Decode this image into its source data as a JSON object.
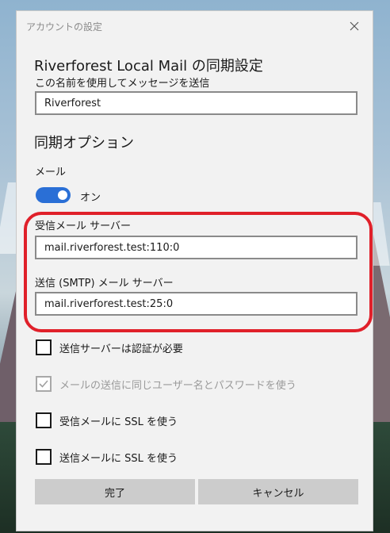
{
  "dialog": {
    "title": "アカウントの設定",
    "heading": "Riverforest Local Mail の同期設定",
    "name_label": "この名前を使用してメッセージを送信",
    "name_value": "Riverforest",
    "sync_options_title": "同期オプション",
    "mail_label": "メール",
    "mail_toggle": {
      "state_text": "オン",
      "on": true,
      "color": "#2a6fd6"
    },
    "incoming_server_label": "受信メール サーバー",
    "incoming_server_value": "mail.riverforest.test:110:0",
    "outgoing_server_label": "送信 (SMTP) メール サーバー",
    "outgoing_server_value": "mail.riverforest.test:25:0",
    "highlight_color": "#e0202a",
    "checkboxes": [
      {
        "label": "送信サーバーは認証が必要",
        "checked": false,
        "disabled": false
      },
      {
        "label": "メールの送信に同じユーザー名とパスワードを使う",
        "checked": true,
        "disabled": true
      },
      {
        "label": "受信メールに SSL を使う",
        "checked": false,
        "disabled": false
      },
      {
        "label": "送信メールに SSL を使う",
        "checked": false,
        "disabled": false
      }
    ],
    "done_button": "完了",
    "cancel_button": "キャンセル"
  }
}
